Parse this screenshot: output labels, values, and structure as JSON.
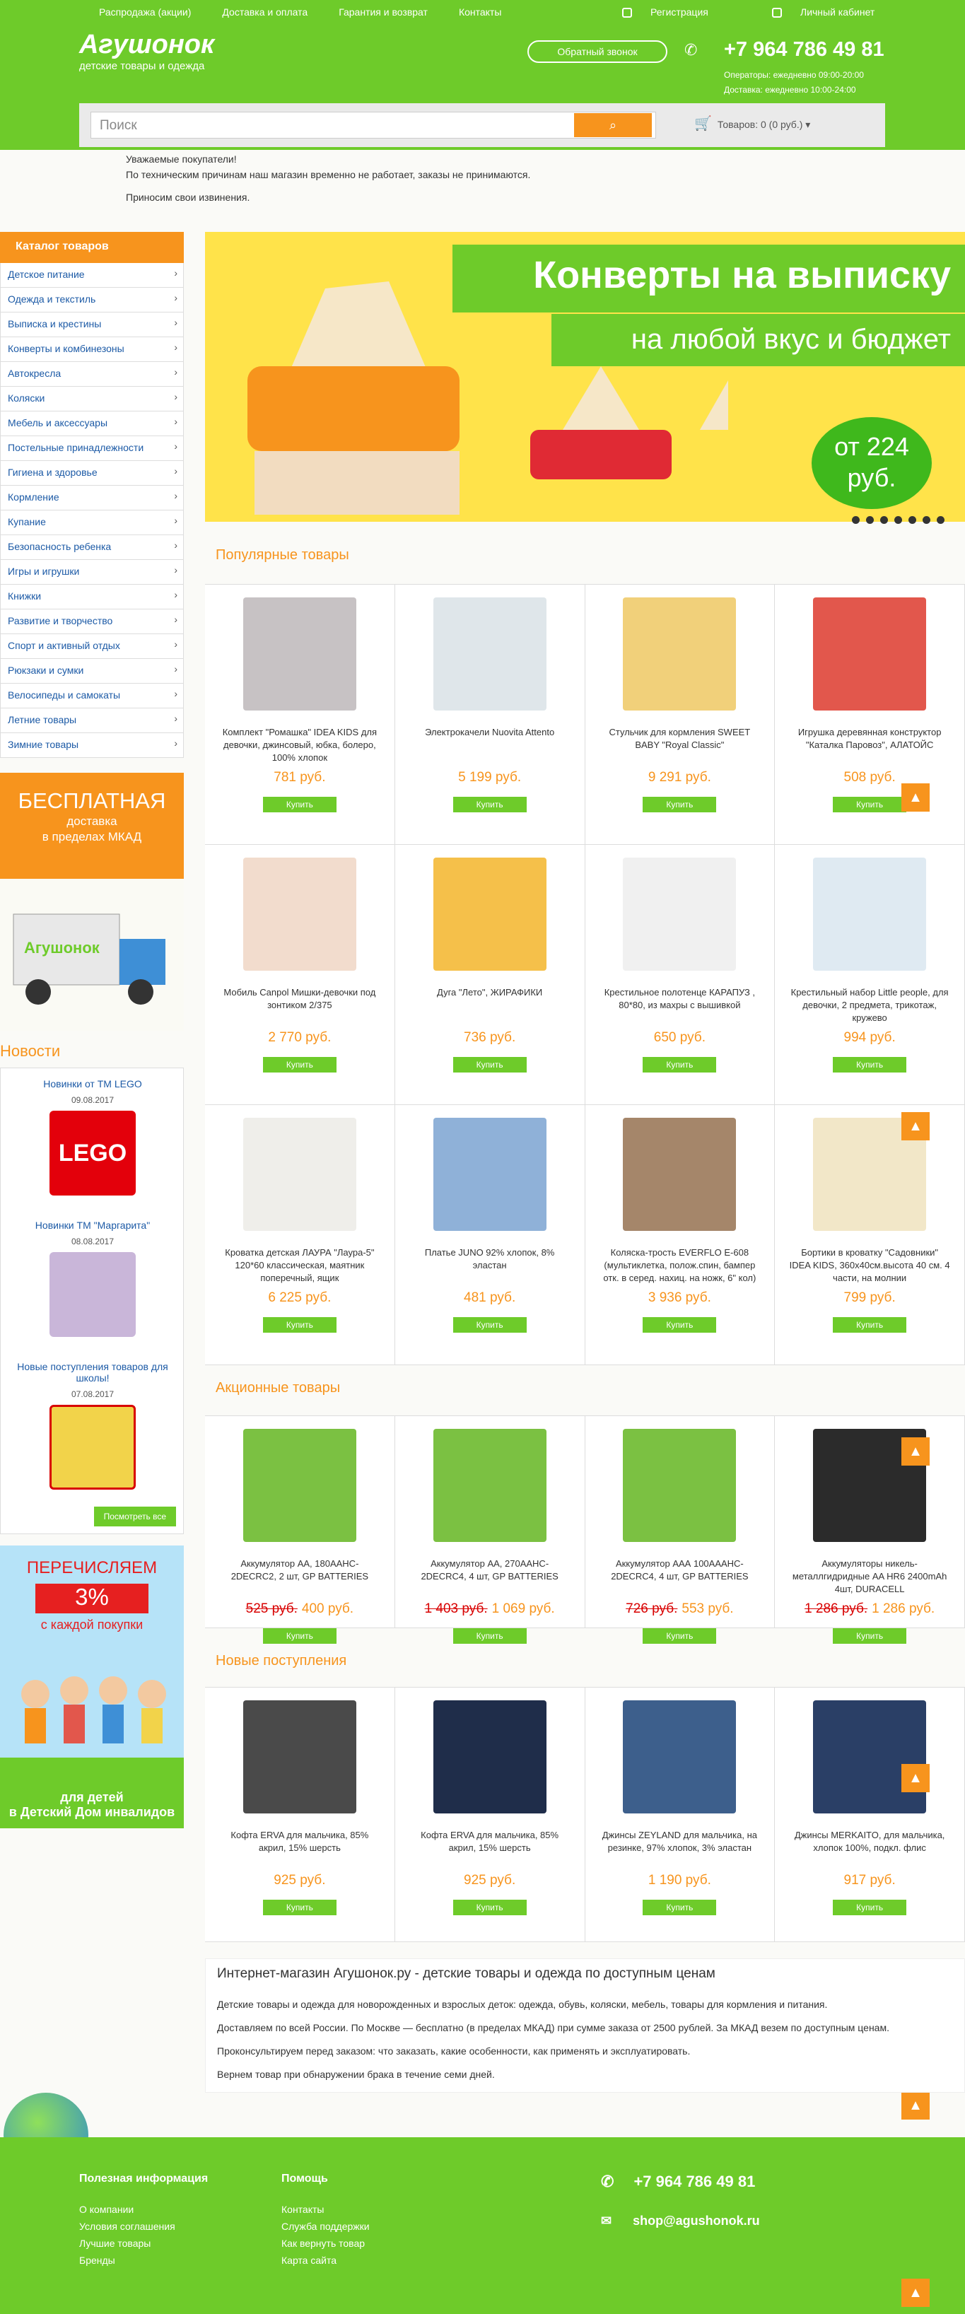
{
  "header": {
    "nav": [
      "Распродажа (акции)",
      "Доставка и оплата",
      "Гарантия и возврат",
      "Контакты"
    ],
    "register": "Регистрация",
    "cabinet": "Личный кабинет",
    "logo_name": "Агушонок",
    "logo_tag": "детские товары и одежда",
    "callback": "Обратный звонок",
    "phone": "+7 964 786 49 81",
    "operators": "Операторы: ежедневно 09:00-20:00",
    "delivery_hours": "Доставка: ежедневно 10:00-24:00",
    "search_placeholder": "Поиск",
    "cart": "Товаров: 0 (0 руб.)"
  },
  "notice": [
    "Уважаемые покупатели!",
    "По техническим причинам наш магазин временно не работает, заказы не принимаются.",
    "Приносим свои извинения."
  ],
  "catalog": {
    "title": "Каталог товаров",
    "items": [
      "Детское питание",
      "Одежда и текстиль",
      "Выписка и крестины",
      "Конверты и комбинезоны",
      "Автокресла",
      "Коляски",
      "Мебель и аксессуары",
      "Постельные принадлежности",
      "Гигиена и здоровье",
      "Кормление",
      "Купание",
      "Безопасность ребенка",
      "Игры и игрушки",
      "Книжки",
      "Развитие и творчество",
      "Спорт и активный отдых",
      "Рюкзаки и сумки",
      "Велосипеды и самокаты",
      "Летние товары",
      "Зимние товары"
    ]
  },
  "promo_delivery": {
    "big": "БЕСПЛАТНАЯ",
    "line1": "доставка",
    "line2": "в пределах МКАД",
    "truck_logo": "Агушонок"
  },
  "news": {
    "title": "Новости",
    "items": [
      {
        "title": "Новинки от TM LEGO",
        "date": "09.08.2017",
        "color": "#e3000b"
      },
      {
        "title": "Новинки ТМ \"Маргарита\"",
        "date": "08.08.2017",
        "color": "#c9b6d9"
      },
      {
        "title": "Новые поступления товаров для школы!",
        "date": "07.08.2017",
        "color": "#f2d34a"
      }
    ],
    "all": "Посмотреть все"
  },
  "promo_charity": {
    "t1": "ПЕРЕЧИСЛЯЕМ",
    "t2": "3%",
    "t3": "с каждой покупки",
    "t4a": "для детей",
    "t4b": "в Детский Дом инвалидов"
  },
  "banner": {
    "line1": "Конверты на выписку",
    "line2": "на любой вкус и бюджет",
    "price1": "от 224",
    "price2": "руб."
  },
  "buy_label": "Купить",
  "popular": {
    "title": "Популярные товары",
    "items": [
      {
        "name": "Комплект \"Ромашка\" IDEA KIDS для девочки, джинсовый, юбка, болеро, 100% хлопок",
        "price": "781 руб.",
        "color": "#c7c2c4"
      },
      {
        "name": "Электрокачели Nuovita Attento",
        "price": "5 199 руб.",
        "color": "#dfe6ea"
      },
      {
        "name": "Стульчик для кормления SWEET BABY \"Royal Classic\"",
        "price": "9 291 руб.",
        "color": "#f1d07a"
      },
      {
        "name": "Игрушка деревянная конструктор \"Каталка Паровоз\", АЛАТОЙС",
        "price": "508 руб.",
        "color": "#e2574c"
      },
      {
        "name": "Мобиль Canpol Мишки-девочки под зонтиком 2/375",
        "price": "2 770 руб.",
        "color": "#f2dccd"
      },
      {
        "name": "Дуга \"Лето\", ЖИРАФИКИ",
        "price": "736 руб.",
        "color": "#f5c04a"
      },
      {
        "name": "Крестильное полотенце КАРАПУЗ , 80*80, из махры с вышивкой",
        "price": "650 руб.",
        "color": "#f0f0f0"
      },
      {
        "name": "Крестильный набор Little people, для девочки, 2 предмета, трикотаж, кружево",
        "price": "994 руб.",
        "color": "#dfeaf2"
      },
      {
        "name": "Кроватка детская ЛАУРА \"Лаура-5\" 120*60 классическая, маятник поперечный, ящик",
        "price": "6 225 руб.",
        "color": "#efeeea"
      },
      {
        "name": "Платье JUNO 92% хлопок, 8% эластан",
        "price": "481 руб.",
        "color": "#8fb1d8"
      },
      {
        "name": "Коляска-трость EVERFLO E-608 (мультиклетка, полож.спин, бампер отк. в серед. нахиц. на ножк, 6\" кол)",
        "price": "3 936 руб.",
        "color": "#a5866a"
      },
      {
        "name": "Бортики в кроватку \"Садовники\" IDEA KIDS, 360х40см.высота 40 см. 4 части, на молнии",
        "price": "799 руб.",
        "color": "#f2e7c8"
      }
    ]
  },
  "sale": {
    "title": "Акционные товары",
    "items": [
      {
        "name": "Аккумулятор AA, 180AAHC-2DECRC2, 2 шт, GP BATTERIES",
        "old": "525 руб.",
        "price": "400 руб.",
        "color": "#7bc142"
      },
      {
        "name": "Аккумулятор AA, 270AAHC-2DECRC4, 4 шт, GP BATTERIES",
        "old": "1 403 руб.",
        "price": "1 069 руб.",
        "color": "#7bc142"
      },
      {
        "name": "Аккумулятор ААА 100AAAHC-2DECRC4, 4 шт, GP BATTERIES",
        "old": "726 руб.",
        "price": "553 руб.",
        "color": "#7bc142"
      },
      {
        "name": "Аккумуляторы никель-металлгидридные AA HR6 2400mAh 4шт, DURACELL",
        "old": "1 286 руб.",
        "price": "1 286 руб.",
        "color": "#2b2b2b"
      }
    ]
  },
  "new": {
    "title": "Новые поступления",
    "items": [
      {
        "name": "Кофта ERVA для мальчика, 85% акрил, 15% шерсть",
        "price": "925 руб.",
        "color": "#4a4a4a"
      },
      {
        "name": "Кофта ERVA для мальчика, 85% акрил, 15% шерсть",
        "price": "925 руб.",
        "color": "#1f2d4a"
      },
      {
        "name": "Джинсы ZEYLAND для мальчика, на резинке, 97% хлопок, 3% эластан",
        "price": "1 190 руб.",
        "color": "#3d5f8c"
      },
      {
        "name": "Джинсы MERKAITO, для мальчика, хлопок 100%, подкл. флис",
        "price": "917 руб.",
        "color": "#2a3f66"
      }
    ]
  },
  "seo": {
    "title": "Интернет-магазин Агушонок.ру - детские товары и одежда по доступным ценам",
    "p": [
      "Детские товары и одежда для новорожденных и взрослых деток: одежда, обувь, коляски, мебель, товары для кормления и питания.",
      "Доставляем по всей России. По Москве — бесплатно (в пределах МКАД) при сумме заказа от 2500 рублей. За МКАД везем по доступным ценам.",
      "Проконсультируем перед заказом: что заказать, какие особенности, как применять и эксплуатировать.",
      "Вернем товар при обнаружении брака в течение семи дней."
    ]
  },
  "footer": {
    "col1_title": "Полезная информация",
    "col1": [
      "О компании",
      "Условия соглашения",
      "Лучшие товары",
      "Бренды"
    ],
    "col2_title": "Помощь",
    "col2": [
      "Контакты",
      "Служба поддержки",
      "Как вернуть товар",
      "Карта сайта"
    ],
    "phone": "+7 964 786 49 81",
    "email": "shop@agushonok.ru"
  }
}
